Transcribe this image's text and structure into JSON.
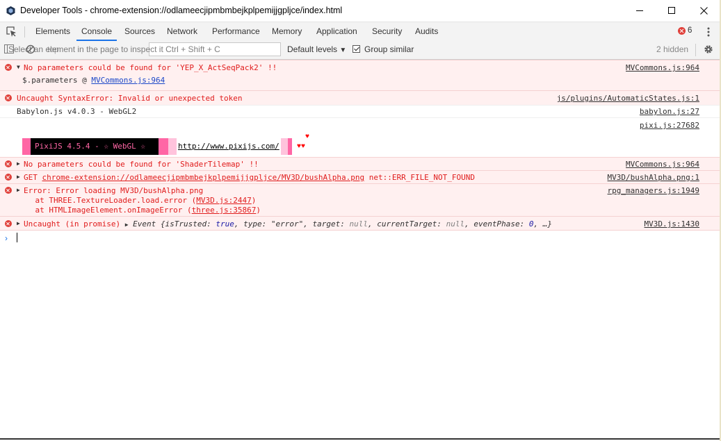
{
  "window": {
    "title": "Developer Tools - chrome-extension://odlameecjipmbmbejkplpemijjgpljce/index.html"
  },
  "tabs": [
    {
      "label": "Elements"
    },
    {
      "label": "Console"
    },
    {
      "label": "Sources"
    },
    {
      "label": "Network"
    },
    {
      "label": "Performance"
    },
    {
      "label": "Memory"
    },
    {
      "label": "Application"
    },
    {
      "label": "Security"
    },
    {
      "label": "Audits"
    }
  ],
  "active_tab": "Console",
  "error_count": "6",
  "toolbar": {
    "context": "top",
    "filter_placeholder": "Filter",
    "inspect_hint": "Select an element in the page to inspect it  Ctrl + Shift + C",
    "levels_label": "Default levels",
    "group_similar_label": "Group similar",
    "group_similar_checked": true,
    "hidden_label": "2 hidden"
  },
  "messages": {
    "m1": {
      "text": "No parameters could be found for 'YEP_X_ActSeqPack2' !!",
      "source": "MVCommons.js:964",
      "sub_prefix": "$.parameters @ ",
      "sub_link": "MVCommons.js:964"
    },
    "m2": {
      "text": "Uncaught SyntaxError: Invalid or unexpected token",
      "source": "js/plugins/AutomaticStates.js:1"
    },
    "m3": {
      "text": "Babylon.js v4.0.3 - WebGL2",
      "source": "babylon.js:27"
    },
    "m4": {
      "source": "pixi.js:27682",
      "banner": "PixiJS 4.5.4 - ☆ WebGL ☆",
      "url": "http://www.pixijs.com/",
      "hearts1": "♥",
      "hearts2": "♥♥"
    },
    "m5": {
      "text": "No parameters could be found for 'ShaderTilemap' !!",
      "source": "MVCommons.js:964"
    },
    "m6": {
      "method": "GET ",
      "url": "chrome-extension://odlameecjipmbmbejkplpemijjgpljce/MV3D/bushAlpha.png",
      "error": " net::ERR_FILE_NOT_FOUND",
      "source": "MV3D/bushAlpha.png:1"
    },
    "m7": {
      "text": "Error: Error loading MV3D/bushAlpha.png",
      "line2_prefix": "    at THREE.TextureLoader.load.error (",
      "line2_link": "MV3D.js:2447",
      "line3_prefix": "    at HTMLImageElement.onImageError (",
      "line3_link": "three.js:35867",
      "close": ")",
      "source": "rpg_managers.js:1949"
    },
    "m8": {
      "text": "Uncaught (in promise) ",
      "event_label": "Event ",
      "obj_open": "{",
      "k1": "isTrusted",
      "v1": "true",
      "k2": "type",
      "v2": "\"error\"",
      "k3": "target",
      "v3": "null",
      "k4": "currentTarget",
      "v4": "null",
      "k5": "eventPhase",
      "v5": "0",
      "tail": ", …}",
      "source": "MV3D.js:1430"
    }
  },
  "colors": {
    "accent": "#1a73e8",
    "error": "#e01b1b",
    "error_bg": "#fff0f0",
    "pixi_pink": "#ff66a5"
  },
  "icons": [
    "app-icon",
    "inspect-icon",
    "error-icon",
    "more-vert-icon",
    "sidebar-icon",
    "clear-icon",
    "checkbox-icon",
    "gear-icon",
    "minimize-icon",
    "maximize-icon",
    "close-icon",
    "prompt-chevron-icon"
  ]
}
